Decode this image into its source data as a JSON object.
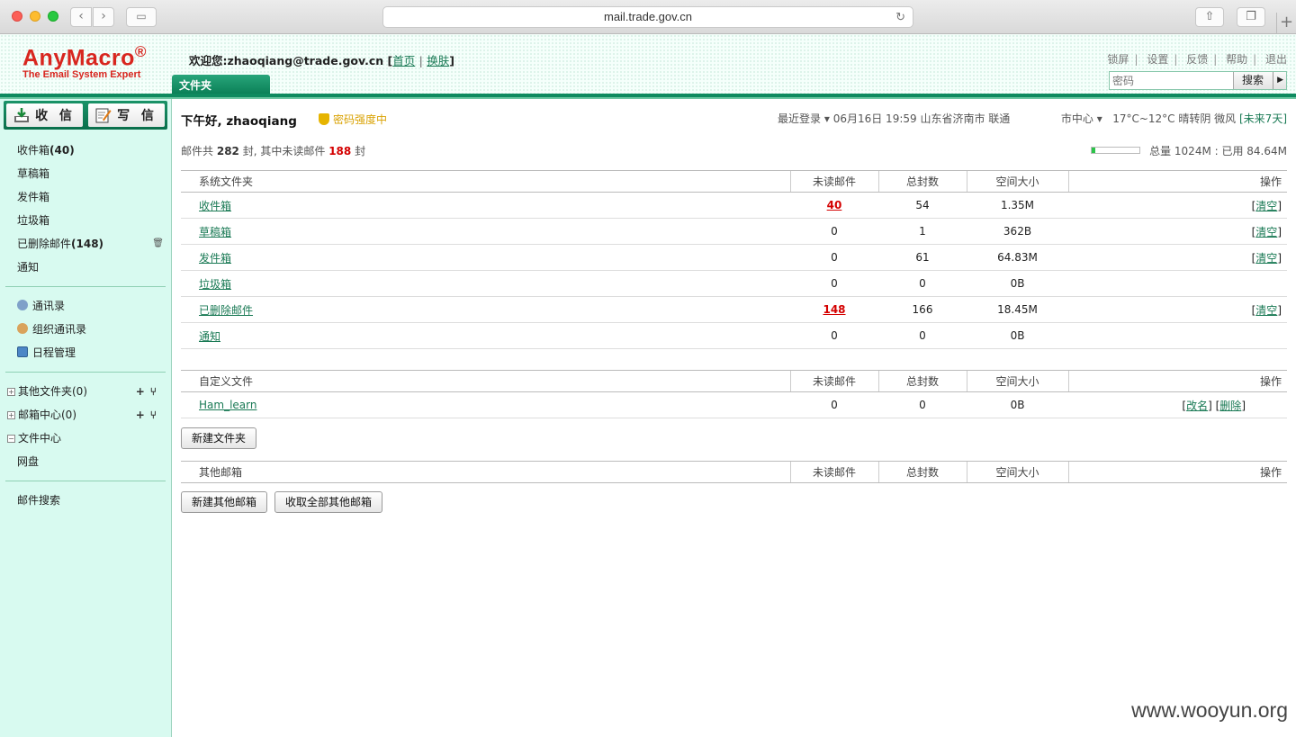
{
  "browser": {
    "url": "mail.trade.gov.cn"
  },
  "brand": {
    "name": "AnyMacro",
    "reg": "®",
    "tagline": "The Email System Expert"
  },
  "header": {
    "welcome": "欢迎您:zhaoqiang@trade.gov.cn",
    "home": "首页",
    "skin": "换肤",
    "links": [
      "锁屏",
      "设置",
      "反馈",
      "帮助",
      "退出"
    ],
    "search_placeholder": "密码",
    "search_button": "搜索",
    "tab": "文件夹"
  },
  "sidebar": {
    "receive": "收 信",
    "write": "写 信",
    "folders": [
      {
        "name": "收件箱",
        "count": "(40)"
      },
      {
        "name": "草稿箱",
        "count": ""
      },
      {
        "name": "发件箱",
        "count": ""
      },
      {
        "name": "垃圾箱",
        "count": ""
      },
      {
        "name": "已删除邮件",
        "count": "(148)"
      },
      {
        "name": "通知",
        "count": ""
      }
    ],
    "tools": [
      "通讯录",
      "组织通讯录",
      "日程管理"
    ],
    "trees": [
      {
        "toggle": "+",
        "label": "其他文件夹(0)"
      },
      {
        "toggle": "+",
        "label": "邮箱中心(0)"
      },
      {
        "toggle": "−",
        "label": "文件中心"
      }
    ],
    "netdisk": "网盘",
    "search": "邮件搜索"
  },
  "main": {
    "greeting": "下午好, zhaoqiang",
    "pwd_strength": "密码强度中",
    "last_login_label": "最近登录",
    "last_login": "06月16日 19:59 山东省济南市 联通",
    "city": "市中心",
    "weather": "17°C~12°C 晴转阴 微风",
    "forecast": "[未来7天]",
    "summary_pre": "邮件共",
    "total": "282",
    "summary_mid": "封,  其中未读邮件",
    "unread": "188",
    "summary_post": "封",
    "quota": "总量 1024M : 已用 84.64M",
    "quota_used_fraction": 0.083,
    "columns": [
      "未读邮件",
      "总封数",
      "空间大小",
      "操作"
    ],
    "system_title": "系统文件夹",
    "system_rows": [
      {
        "name": "收件箱",
        "unread": "40",
        "total": "54",
        "size": "1.35M",
        "action": "清空",
        "hot": true
      },
      {
        "name": "草稿箱",
        "unread": "0",
        "total": "1",
        "size": "362B",
        "action": "清空",
        "hot": false
      },
      {
        "name": "发件箱",
        "unread": "0",
        "total": "61",
        "size": "64.83M",
        "action": "清空",
        "hot": false
      },
      {
        "name": "垃圾箱",
        "unread": "0",
        "total": "0",
        "size": "0B",
        "action": "",
        "hot": false
      },
      {
        "name": "已删除邮件",
        "unread": "148",
        "total": "166",
        "size": "18.45M",
        "action": "清空",
        "hot": true
      },
      {
        "name": "通知",
        "unread": "0",
        "total": "0",
        "size": "0B",
        "action": "",
        "hot": false
      }
    ],
    "custom_title": "自定义文件",
    "custom_rows": [
      {
        "name": "Ham_learn",
        "unread": "0",
        "total": "0",
        "size": "0B",
        "rename": "改名",
        "delete": "删除"
      }
    ],
    "new_folder": "新建文件夹",
    "other_title": "其他邮箱",
    "new_other": "新建其他邮箱",
    "fetch_all": "收取全部其他邮箱"
  },
  "watermark": "www.wooyun.org"
}
